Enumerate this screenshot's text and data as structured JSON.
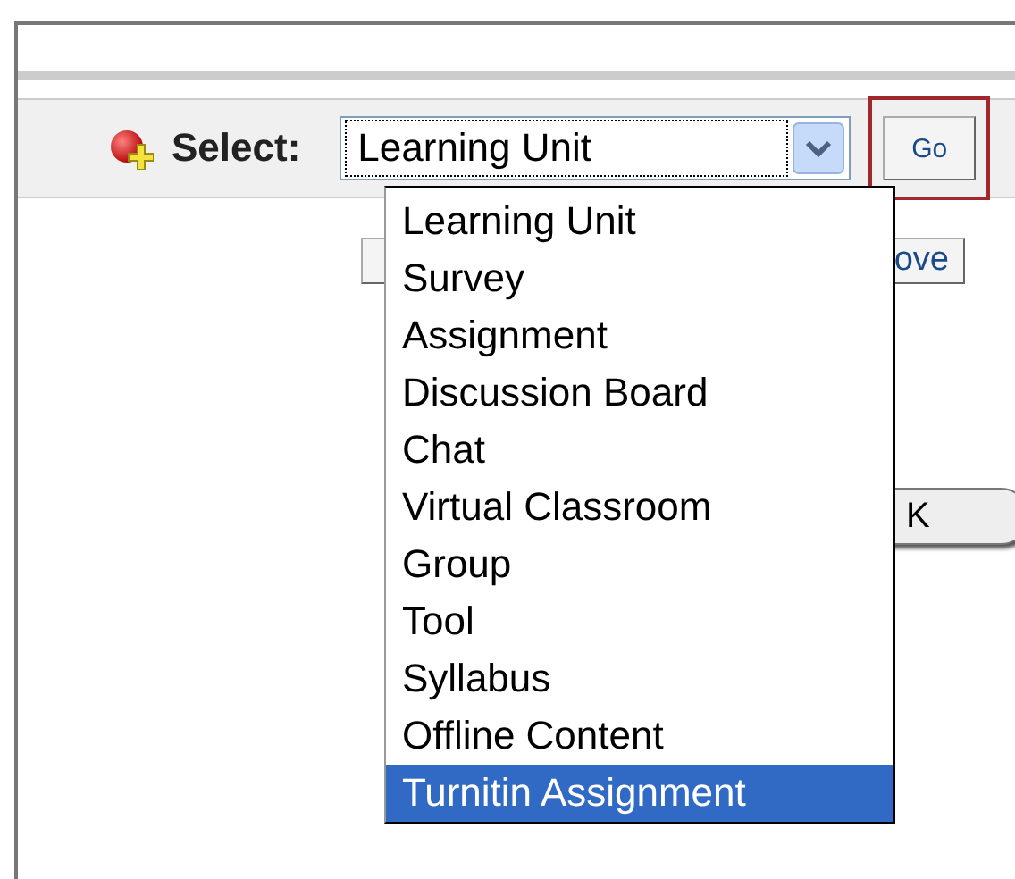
{
  "toolbar": {
    "label": "Select:",
    "select": {
      "value": "Learning Unit",
      "expanded": true
    },
    "go_button": {
      "label": "Go",
      "focused": true
    }
  },
  "options": [
    {
      "label": "Learning Unit",
      "selected": false
    },
    {
      "label": "Survey",
      "selected": false
    },
    {
      "label": "Assignment",
      "selected": false
    },
    {
      "label": "Discussion Board",
      "selected": false
    },
    {
      "label": "Chat",
      "selected": false
    },
    {
      "label": "Virtual Classroom",
      "selected": false
    },
    {
      "label": "Group",
      "selected": false
    },
    {
      "label": "Tool",
      "selected": false
    },
    {
      "label": "Syllabus",
      "selected": false
    },
    {
      "label": "Offline Content",
      "selected": false
    },
    {
      "label": "Turnitin Assignment",
      "selected": true
    }
  ],
  "hidden_buttons": [
    {
      "label": "ove",
      "kind": "square"
    },
    {
      "label": "K",
      "kind": "pill"
    }
  ]
}
